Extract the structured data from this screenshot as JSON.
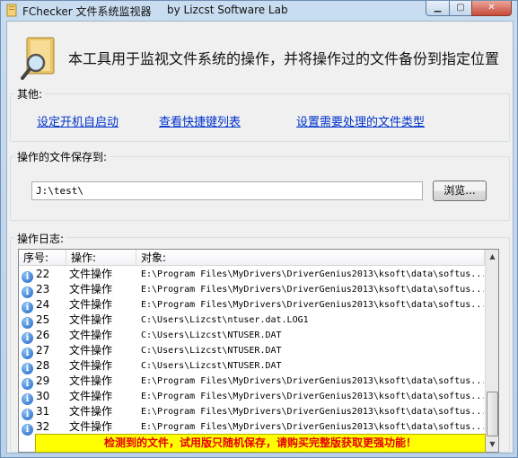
{
  "window": {
    "title": "FChecker 文件系统监视器",
    "byline": "by Lizcst Software Lab",
    "min_glyph": "▁",
    "max_glyph": "▢",
    "close_glyph": "✕"
  },
  "banner": {
    "text": "本工具用于监视文件系统的操作，并将操作过的文件备份到指定位置"
  },
  "other_group": {
    "label": "其他:",
    "links": [
      "设定开机自启动",
      "查看快捷键列表",
      "设置需要处理的文件类型"
    ]
  },
  "save_group": {
    "label": "操作的文件保存到:",
    "path_value": "J:\\test\\",
    "browse_label": "浏览..."
  },
  "log_group": {
    "label": "操作日志:",
    "columns": [
      "序号:",
      "操作:",
      "对象:"
    ],
    "rows": [
      {
        "no": "22",
        "op": "文件操作",
        "obj": "E:\\Program Files\\MyDrivers\\DriverGenius2013\\ksoft\\data\\softus..."
      },
      {
        "no": "23",
        "op": "文件操作",
        "obj": "E:\\Program Files\\MyDrivers\\DriverGenius2013\\ksoft\\data\\softus..."
      },
      {
        "no": "24",
        "op": "文件操作",
        "obj": "E:\\Program Files\\MyDrivers\\DriverGenius2013\\ksoft\\data\\softus..."
      },
      {
        "no": "25",
        "op": "文件操作",
        "obj": "C:\\Users\\Lizcst\\ntuser.dat.LOG1"
      },
      {
        "no": "26",
        "op": "文件操作",
        "obj": "C:\\Users\\Lizcst\\NTUSER.DAT"
      },
      {
        "no": "27",
        "op": "文件操作",
        "obj": "C:\\Users\\Lizcst\\NTUSER.DAT"
      },
      {
        "no": "28",
        "op": "文件操作",
        "obj": "C:\\Users\\Lizcst\\NTUSER.DAT"
      },
      {
        "no": "29",
        "op": "文件操作",
        "obj": "E:\\Program Files\\MyDrivers\\DriverGenius2013\\ksoft\\data\\softus..."
      },
      {
        "no": "30",
        "op": "文件操作",
        "obj": "E:\\Program Files\\MyDrivers\\DriverGenius2013\\ksoft\\data\\softus..."
      },
      {
        "no": "31",
        "op": "文件操作",
        "obj": "E:\\Program Files\\MyDrivers\\DriverGenius2013\\ksoft\\data\\softus..."
      },
      {
        "no": "32",
        "op": "文件操作",
        "obj": "E:\\Program Files\\MyDrivers\\DriverGenius2013\\ksoft\\data\\softus..."
      }
    ],
    "row_icon": "info-icon",
    "row_icon_glyph": "i"
  },
  "warning": {
    "text": "检测到的文件，试用版只随机保存，请购买完整版获取更强功能！"
  }
}
